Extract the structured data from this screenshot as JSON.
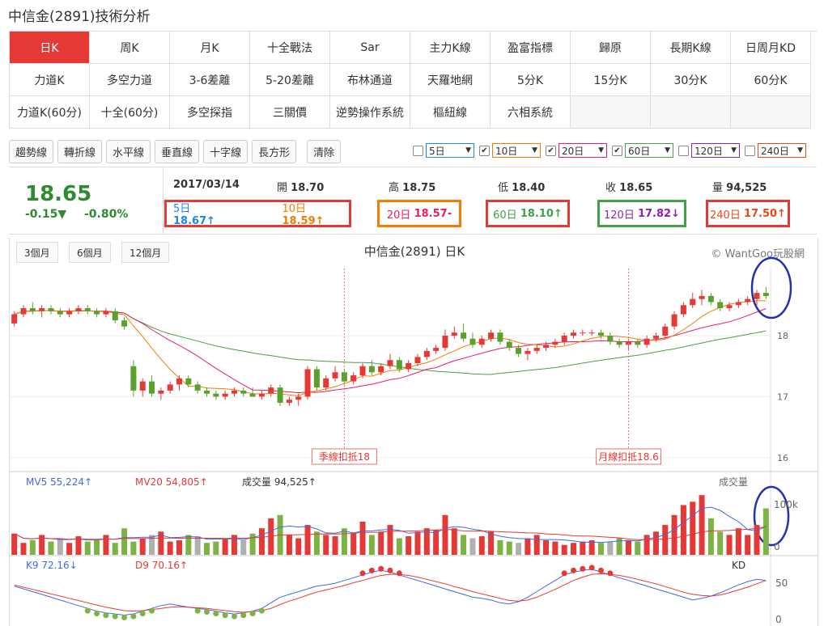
{
  "page": {
    "title": "中信金(2891)技術分析"
  },
  "tabs": [
    [
      "日K",
      "周K",
      "月K",
      "十全戰法",
      "Sar",
      "主力K線",
      "盈富指標",
      "歸原",
      "長期K線",
      "日周月KD"
    ],
    [
      "力道K",
      "多空力道",
      "3-6差離",
      "5-20差離",
      "布林通道",
      "天羅地網",
      "5分K",
      "15分K",
      "30分K",
      "60分K"
    ],
    [
      "力道K(60分)",
      "十全(60分)",
      "多空探指",
      "三關價",
      "逆勢操作系統",
      "樞紐線",
      "六相系統"
    ]
  ],
  "toolbar": [
    "趨勢線",
    "轉折線",
    "水平線",
    "垂直線",
    "十字線",
    "長方形",
    "清除"
  ],
  "ma_selectors": [
    {
      "label": "5日",
      "checked": false,
      "color": "#1e88e5"
    },
    {
      "label": "10日",
      "checked": true,
      "color": "#f57c00"
    },
    {
      "label": "20日",
      "checked": true,
      "color": "#e91e63"
    },
    {
      "label": "60日",
      "checked": true,
      "color": "#43a047"
    },
    {
      "label": "120日",
      "checked": false,
      "color": "#8e24aa"
    },
    {
      "label": "240日",
      "checked": false,
      "color": "#e64a19"
    }
  ],
  "quote": {
    "price": "18.65",
    "change": "-0.15▼",
    "percent": "-0.80%",
    "date": "2017/03/14",
    "open_label": "開",
    "open": "18.70",
    "high_label": "高",
    "high": "18.75",
    "low_label": "低",
    "low": "18.40",
    "close_label": "收",
    "close": "18.65",
    "vol_label": "量",
    "vol": "94,525"
  },
  "ma_values": [
    {
      "label": "5日",
      "value": "18.67↑",
      "color": "#1e88e5"
    },
    {
      "label": "10日",
      "value": "18.59↑",
      "color": "#f57c00"
    },
    {
      "label": "20日",
      "value": "18.57-",
      "color": "#e91e63"
    },
    {
      "label": "60日",
      "value": "18.10↑",
      "color": "#43a047"
    },
    {
      "label": "120日",
      "value": "17.82↓",
      "color": "#8e24aa"
    },
    {
      "label": "240日",
      "value": "17.50↑",
      "color": "#e64a19"
    }
  ],
  "period_buttons": [
    "3個月",
    "6個月",
    "12個月"
  ],
  "chart": {
    "title": "中信金(2891) 日K",
    "credit": "© WantGoo玩股網"
  },
  "annotations": [
    "季線扣抵18",
    "月線扣抵18.6"
  ],
  "volume_panel": {
    "mv5_label": "MV5",
    "mv5": "55,224↑",
    "mv20_label": "MV20",
    "mv20": "54,805↑",
    "vol_label": "成交量",
    "vol": "94,525↑",
    "title": "成交量",
    "tick_top": "100k",
    "tick_bottom": "0"
  },
  "kd_panel": {
    "k_label": "K9",
    "k": "72.16↓",
    "d_label": "D9",
    "d": "70.16↑",
    "title": "KD",
    "ticks": [
      "50",
      "0"
    ]
  },
  "chart_data": {
    "type": "candlestick",
    "y_ticks": [
      "18",
      "17",
      "16"
    ],
    "ylim": [
      15.8,
      19.1
    ],
    "candles": [
      [
        18.2,
        18.4,
        18.15,
        18.35
      ],
      [
        18.35,
        18.5,
        18.3,
        18.45
      ],
      [
        18.45,
        18.55,
        18.35,
        18.4
      ],
      [
        18.4,
        18.5,
        18.3,
        18.45
      ],
      [
        18.45,
        18.5,
        18.35,
        18.4
      ],
      [
        18.4,
        18.45,
        18.3,
        18.35
      ],
      [
        18.35,
        18.45,
        18.3,
        18.4
      ],
      [
        18.4,
        18.5,
        18.35,
        18.45
      ],
      [
        18.45,
        18.5,
        18.35,
        18.4
      ],
      [
        18.4,
        18.45,
        18.3,
        18.35
      ],
      [
        18.35,
        18.45,
        18.3,
        18.4
      ],
      [
        18.4,
        18.45,
        18.2,
        18.25
      ],
      [
        18.25,
        18.3,
        18.1,
        18.15
      ],
      [
        17.5,
        17.6,
        17.0,
        17.1
      ],
      [
        17.1,
        17.3,
        17.0,
        17.25
      ],
      [
        17.25,
        17.35,
        17.0,
        17.05
      ],
      [
        17.05,
        17.15,
        16.95,
        17.1
      ],
      [
        17.1,
        17.25,
        17.05,
        17.2
      ],
      [
        17.2,
        17.35,
        17.1,
        17.3
      ],
      [
        17.3,
        17.35,
        17.15,
        17.2
      ],
      [
        17.2,
        17.25,
        17.05,
        17.1
      ],
      [
        17.1,
        17.15,
        17.0,
        17.05
      ],
      [
        17.05,
        17.1,
        16.95,
        17.0
      ],
      [
        17.0,
        17.1,
        16.95,
        17.05
      ],
      [
        17.05,
        17.15,
        17.0,
        17.1
      ],
      [
        17.1,
        17.15,
        17.0,
        17.05
      ],
      [
        17.05,
        17.15,
        17.0,
        17.0
      ],
      [
        17.0,
        17.1,
        16.95,
        17.05
      ],
      [
        17.05,
        17.2,
        17.0,
        17.15
      ],
      [
        17.15,
        17.2,
        16.85,
        16.9
      ],
      [
        16.9,
        17.0,
        16.85,
        16.95
      ],
      [
        16.95,
        17.05,
        16.85,
        17.0
      ],
      [
        17.0,
        17.5,
        16.95,
        17.45
      ],
      [
        17.45,
        17.5,
        17.1,
        17.15
      ],
      [
        17.15,
        17.35,
        17.1,
        17.3
      ],
      [
        17.3,
        17.5,
        17.25,
        17.4
      ],
      [
        17.4,
        17.45,
        17.2,
        17.25
      ],
      [
        17.25,
        17.4,
        17.2,
        17.35
      ],
      [
        17.35,
        17.55,
        17.3,
        17.5
      ],
      [
        17.5,
        17.6,
        17.35,
        17.4
      ],
      [
        17.4,
        17.55,
        17.35,
        17.5
      ],
      [
        17.5,
        17.7,
        17.45,
        17.6
      ],
      [
        17.6,
        17.65,
        17.4,
        17.45
      ],
      [
        17.45,
        17.6,
        17.4,
        17.55
      ],
      [
        17.55,
        17.7,
        17.5,
        17.65
      ],
      [
        17.65,
        17.8,
        17.6,
        17.75
      ],
      [
        17.75,
        17.85,
        17.7,
        17.8
      ],
      [
        17.8,
        18.1,
        17.75,
        18.0
      ],
      [
        18.0,
        18.15,
        17.95,
        18.05
      ],
      [
        18.05,
        18.2,
        17.9,
        17.95
      ],
      [
        17.95,
        18.05,
        17.8,
        17.85
      ],
      [
        17.85,
        18.0,
        17.8,
        17.95
      ],
      [
        17.95,
        18.1,
        17.9,
        18.05
      ],
      [
        18.05,
        18.1,
        17.85,
        17.9
      ],
      [
        17.9,
        17.95,
        17.75,
        17.8
      ],
      [
        17.8,
        17.85,
        17.65,
        17.7
      ],
      [
        17.7,
        17.8,
        17.6,
        17.75
      ],
      [
        17.75,
        17.85,
        17.7,
        17.8
      ],
      [
        17.8,
        17.9,
        17.75,
        17.85
      ],
      [
        17.85,
        17.95,
        17.8,
        17.9
      ],
      [
        17.9,
        18.05,
        17.85,
        18.0
      ],
      [
        18.0,
        18.1,
        17.95,
        18.05
      ],
      [
        18.05,
        18.1,
        18.0,
        18.05
      ],
      [
        18.05,
        18.1,
        18.0,
        18.05
      ],
      [
        18.05,
        18.1,
        17.95,
        18.0
      ],
      [
        18.0,
        18.05,
        17.85,
        17.9
      ],
      [
        17.9,
        17.95,
        17.8,
        17.85
      ],
      [
        17.85,
        17.95,
        17.75,
        17.9
      ],
      [
        17.9,
        17.95,
        17.8,
        17.85
      ],
      [
        17.85,
        18.0,
        17.8,
        17.95
      ],
      [
        17.95,
        18.05,
        17.9,
        18.0
      ],
      [
        18.0,
        18.2,
        17.95,
        18.15
      ],
      [
        18.15,
        18.4,
        18.1,
        18.35
      ],
      [
        18.35,
        18.55,
        18.3,
        18.5
      ],
      [
        18.5,
        18.7,
        18.45,
        18.6
      ],
      [
        18.6,
        18.75,
        18.5,
        18.65
      ],
      [
        18.65,
        18.7,
        18.5,
        18.55
      ],
      [
        18.55,
        18.6,
        18.4,
        18.45
      ],
      [
        18.45,
        18.55,
        18.4,
        18.5
      ],
      [
        18.5,
        18.6,
        18.45,
        18.55
      ],
      [
        18.55,
        18.65,
        18.5,
        18.6
      ],
      [
        18.6,
        18.75,
        18.5,
        18.7
      ],
      [
        18.7,
        18.8,
        18.6,
        18.65
      ]
    ],
    "volume_ratio": [
      0.32,
      0.18,
      0.22,
      0.3,
      0.2,
      0.25,
      0.18,
      0.28,
      0.2,
      0.22,
      0.3,
      0.18,
      0.4,
      0.2,
      0.25,
      0.3,
      0.35,
      0.2,
      0.22,
      0.3,
      0.28,
      0.18,
      0.2,
      0.25,
      0.3,
      0.22,
      0.32,
      0.4,
      0.55,
      0.6,
      0.3,
      0.25,
      0.45,
      0.35,
      0.3,
      0.28,
      0.4,
      0.32,
      0.5,
      0.3,
      0.35,
      0.45,
      0.25,
      0.28,
      0.35,
      0.4,
      0.38,
      0.6,
      0.4,
      0.3,
      0.25,
      0.28,
      0.35,
      0.22,
      0.2,
      0.18,
      0.25,
      0.3,
      0.22,
      0.2,
      0.15,
      0.18,
      0.2,
      0.22,
      0.18,
      0.2,
      0.25,
      0.22,
      0.2,
      0.3,
      0.35,
      0.45,
      0.6,
      0.75,
      0.8,
      0.9,
      0.55,
      0.35,
      0.3,
      0.4,
      0.3,
      0.45,
      0.7
    ],
    "k_values": [
      60,
      55,
      50,
      45,
      40,
      35,
      30,
      25,
      20,
      15,
      12,
      10,
      8,
      10,
      15,
      20,
      25,
      28,
      25,
      22,
      20,
      18,
      15,
      12,
      10,
      12,
      15,
      20,
      30,
      40,
      45,
      50,
      55,
      60,
      62,
      65,
      70,
      75,
      80,
      85,
      88,
      85,
      80,
      75,
      70,
      65,
      60,
      55,
      50,
      45,
      40,
      38,
      35,
      30,
      28,
      32,
      40,
      50,
      60,
      70,
      80,
      85,
      88,
      90,
      85,
      80,
      75,
      70,
      65,
      60,
      55,
      50,
      45,
      40,
      35,
      38,
      42,
      48,
      55,
      62,
      68,
      72,
      70
    ],
    "d_values": [
      62,
      58,
      54,
      50,
      46,
      42,
      38,
      34,
      30,
      26,
      22,
      19,
      16,
      15,
      16,
      18,
      20,
      22,
      23,
      22,
      21,
      20,
      18,
      16,
      14,
      13,
      14,
      16,
      20,
      27,
      33,
      38,
      44,
      49,
      53,
      57,
      61,
      66,
      70,
      75,
      79,
      81,
      81,
      79,
      76,
      72,
      68,
      64,
      59,
      55,
      50,
      46,
      42,
      38,
      34,
      33,
      35,
      40,
      47,
      54,
      62,
      70,
      76,
      81,
      82,
      81,
      79,
      76,
      72,
      68,
      64,
      59,
      54,
      49,
      45,
      43,
      42,
      44,
      48,
      53,
      58,
      64,
      70
    ]
  }
}
